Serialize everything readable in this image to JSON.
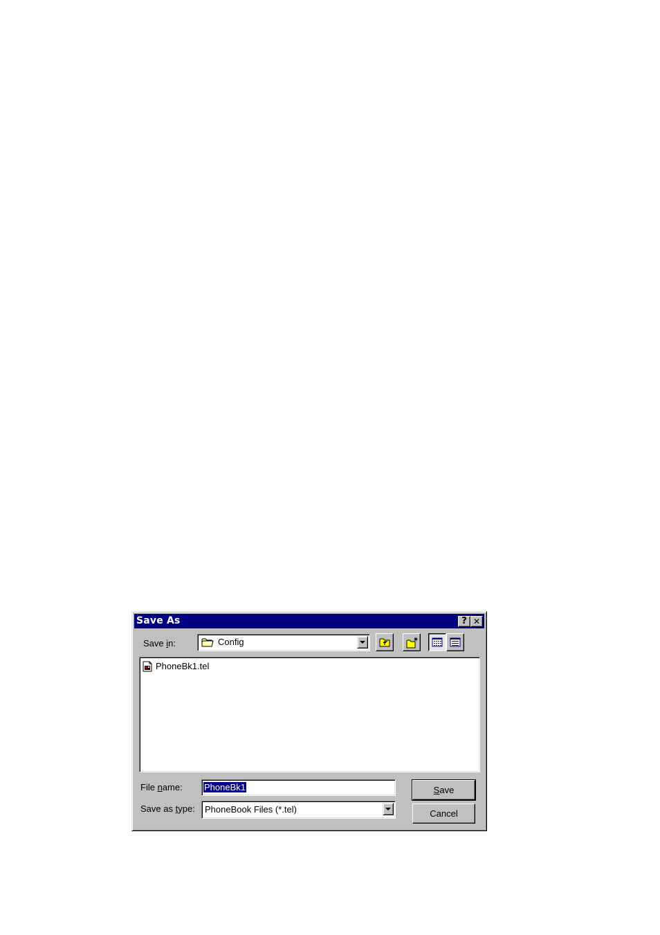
{
  "dialog": {
    "title": "Save As",
    "help_label": "?",
    "close_label": "✕"
  },
  "save_in": {
    "label_pre": "Save ",
    "label_accel": "i",
    "label_post": "n:",
    "folder_icon": "folder-icon",
    "value": "Config"
  },
  "toolbar": {
    "buttons": [
      "up-one-level",
      "create-new-folder",
      "list-view",
      "details-view"
    ],
    "list_view_pressed": true
  },
  "files": [
    {
      "name": "PhoneBk1.tel",
      "icon": "phonebook-file-icon"
    }
  ],
  "file_name": {
    "label_pre": "File ",
    "label_accel": "n",
    "label_post": "ame:",
    "value": "PhoneBk1",
    "selected": true
  },
  "save_as_type": {
    "label_pre": "Save as ",
    "label_accel": "t",
    "label_post": "ype:",
    "value": "PhoneBook Files (*.tel)"
  },
  "buttons": {
    "save_accel": "S",
    "save_rest": "ave",
    "cancel": "Cancel"
  },
  "colors": {
    "titlebar": "#000080",
    "face": "#c0c0c0",
    "selection": "#000080"
  }
}
